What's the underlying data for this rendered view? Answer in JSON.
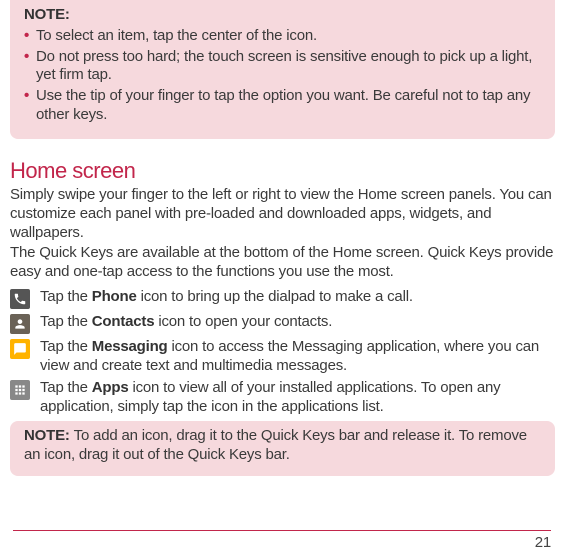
{
  "note1": {
    "label": "NOTE:",
    "items": [
      "To select an item, tap the center of the icon.",
      "Do not press too hard; the touch screen is sensitive enough to pick up a light, yet firm tap.",
      "Use the tip of your finger to tap the option you want. Be careful not to tap any other keys."
    ]
  },
  "section": {
    "title": "Home screen",
    "para1": "Simply swipe your finger to the left or right to view the Home screen panels. You can customize each panel with pre-loaded and downloaded apps, widgets, and wallpapers.",
    "para2": "The Quick Keys are available at the bottom of the Home screen. Quick Keys provide easy and one-tap access to the functions you use the most.",
    "items": {
      "phone": {
        "t1": "Tap the ",
        "b": "Phone",
        "t2": " icon to bring up the dialpad to make a call."
      },
      "contacts": {
        "t1": "Tap the ",
        "b": "Contacts",
        "t2": " icon to open your contacts."
      },
      "messaging": {
        "t1": "Tap the ",
        "b": "Messaging",
        "t2": " icon to access the Messaging application, where you can view and create text and multimedia messages."
      },
      "apps": {
        "t1": "Tap the ",
        "b": "Apps",
        "t2": " icon to view all of your installed applications. To open any application, simply tap the icon in the applications list."
      }
    }
  },
  "note2": {
    "label": "NOTE: ",
    "text": "To add an icon, drag it to the Quick Keys bar and release it. To remove an icon, drag it out of the Quick Keys bar."
  },
  "page": "21"
}
